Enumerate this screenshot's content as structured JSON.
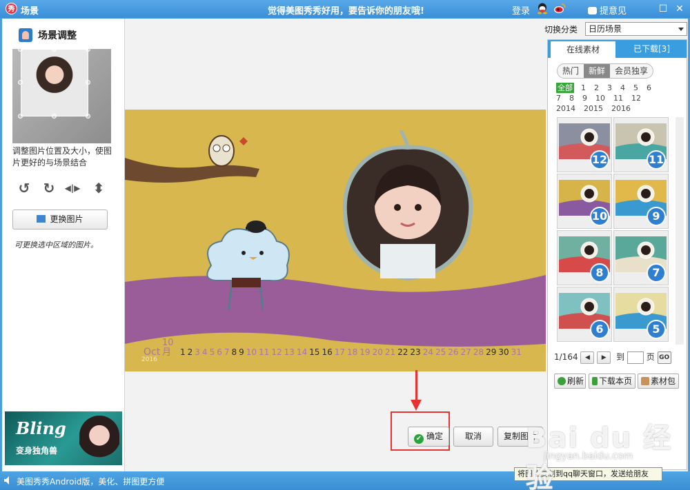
{
  "titlebar": {
    "logo_char": "秀",
    "title": "场景",
    "slogan": "觉得美图秀秀好用，要告诉你的朋友哦!",
    "login": "登录",
    "feedback": "提意见",
    "maximize_glyph": "☐",
    "close_glyph": "✕"
  },
  "left_panel": {
    "heading": "场景调整",
    "description": "调整图片位置及大小，使图片更好的与场景结合",
    "tools": {
      "rotate_left": "↺",
      "rotate_right": "↻",
      "flip_horizontal": "◀|▶",
      "flip_vertical": "⬍"
    },
    "replace_button": "更换图片",
    "hint": "可更换选中区域的图片。",
    "ad": {
      "title": "Bling",
      "subtitle": "变身独角兽"
    }
  },
  "canvas": {
    "month_en": "Oct",
    "month_num": "10",
    "month_cn": "月",
    "year": "2016",
    "days": [
      {
        "d": "1",
        "dark": true
      },
      {
        "d": "2",
        "dark": true
      },
      {
        "d": "3",
        "dark": false
      },
      {
        "d": "4",
        "dark": false
      },
      {
        "d": "5",
        "dark": false
      },
      {
        "d": "6",
        "dark": false
      },
      {
        "d": "7",
        "dark": false
      },
      {
        "d": "8",
        "dark": true
      },
      {
        "d": "9",
        "dark": true
      },
      {
        "d": "10",
        "dark": false
      },
      {
        "d": "11",
        "dark": false
      },
      {
        "d": "12",
        "dark": false
      },
      {
        "d": "13",
        "dark": false
      },
      {
        "d": "14",
        "dark": false
      },
      {
        "d": "15",
        "dark": true
      },
      {
        "d": "16",
        "dark": true
      },
      {
        "d": "17",
        "dark": false
      },
      {
        "d": "18",
        "dark": false
      },
      {
        "d": "19",
        "dark": false
      },
      {
        "d": "20",
        "dark": false
      },
      {
        "d": "21",
        "dark": false
      },
      {
        "d": "22",
        "dark": true
      },
      {
        "d": "23",
        "dark": true
      },
      {
        "d": "24",
        "dark": false
      },
      {
        "d": "25",
        "dark": false
      },
      {
        "d": "26",
        "dark": false
      },
      {
        "d": "27",
        "dark": false
      },
      {
        "d": "28",
        "dark": false
      },
      {
        "d": "29",
        "dark": true
      },
      {
        "d": "30",
        "dark": true
      },
      {
        "d": "31",
        "dark": false
      }
    ]
  },
  "buttons": {
    "ok": "确定",
    "cancel": "取消",
    "copy": "复制图片"
  },
  "right_panel": {
    "switch_label": "切换分类",
    "category": "日历场景",
    "tabs": [
      "在线素材",
      "已下载[3]"
    ],
    "filters": [
      "热门",
      "新鲜",
      "会员独享"
    ],
    "active_filter": "新鲜",
    "date_all": "全部",
    "months_row1": [
      "1",
      "2",
      "3",
      "4",
      "5",
      "6"
    ],
    "months_row2": [
      "7",
      "8",
      "9",
      "10",
      "11",
      "12"
    ],
    "years": [
      "2014",
      "2015",
      "2016"
    ],
    "thumbnails": [
      "12",
      "11",
      "10",
      "9",
      "8",
      "7",
      "6",
      "5"
    ],
    "pager": {
      "page_info": "1/164",
      "prev": "◀",
      "next": "▶",
      "to_label": "到",
      "page_label": "页",
      "go": "GO"
    },
    "actions": [
      "刷新",
      "下载本页",
      "素材包"
    ]
  },
  "tooltip": "将图片复制到qq聊天窗口，发送给朋友",
  "statusbar": {
    "message": "美图秀秀Android版，美化、拼图更方便"
  },
  "watermark": {
    "text": "Bai du 经验",
    "sub": "jingyan.baidu.com"
  },
  "colors": {
    "titlebar": "#3a8fd8",
    "canvas_bg": "#d8b84e",
    "wave_purple": "#9b5c9a",
    "highlight_red": "#e83232",
    "badge_blue": "#2f7fd1",
    "date_green": "#36a83a"
  }
}
